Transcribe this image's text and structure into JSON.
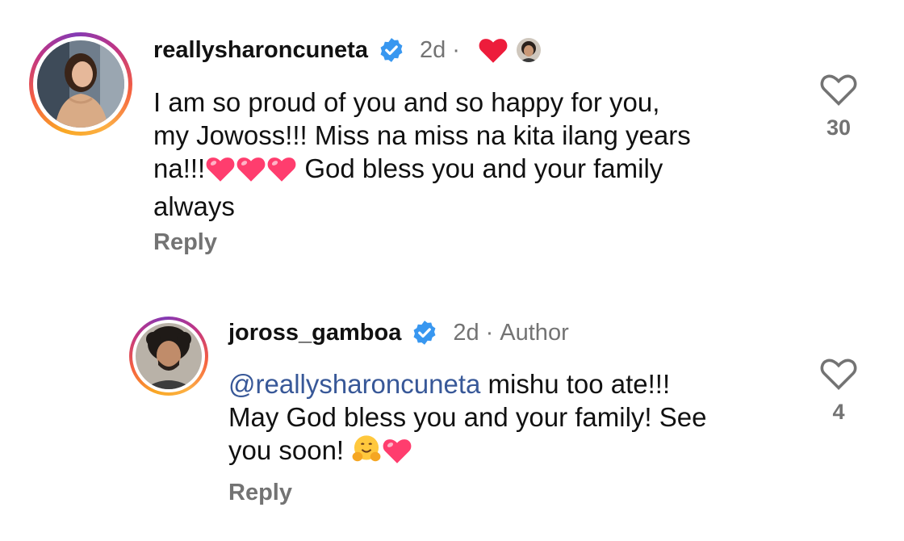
{
  "comments": [
    {
      "username": "reallysharoncuneta",
      "time": "2d",
      "dot": "·",
      "body_lines": [
        "I am so proud of you and so happy for you,",
        "my Jowoss!!! Miss na miss na kita ilang years",
        "na!!!",
        "God bless you and your family",
        "always"
      ],
      "reply_label": "Reply",
      "like_count": "30"
    },
    {
      "username": "joross_gamboa",
      "time": "2d",
      "dot": "·",
      "author_label": "Author",
      "mention": "@reallysharoncuneta",
      "body_lines": [
        "mishu too ate!!!",
        "May God bless you and your family! See",
        "you soon!"
      ],
      "reply_label": "Reply",
      "like_count": "4"
    }
  ],
  "colors": {
    "verified_blue": "#3897f0",
    "heart_red": "#ed1c3b",
    "emoji_heart_pink": "#ff3d6e",
    "mention_blue": "#385898",
    "muted_gray": "#737373"
  },
  "icons": [
    "verified-badge-icon",
    "heart-outline-icon",
    "creator-liked-heart-icon",
    "heart-emoji-icon",
    "hug-emoji-icon"
  ]
}
